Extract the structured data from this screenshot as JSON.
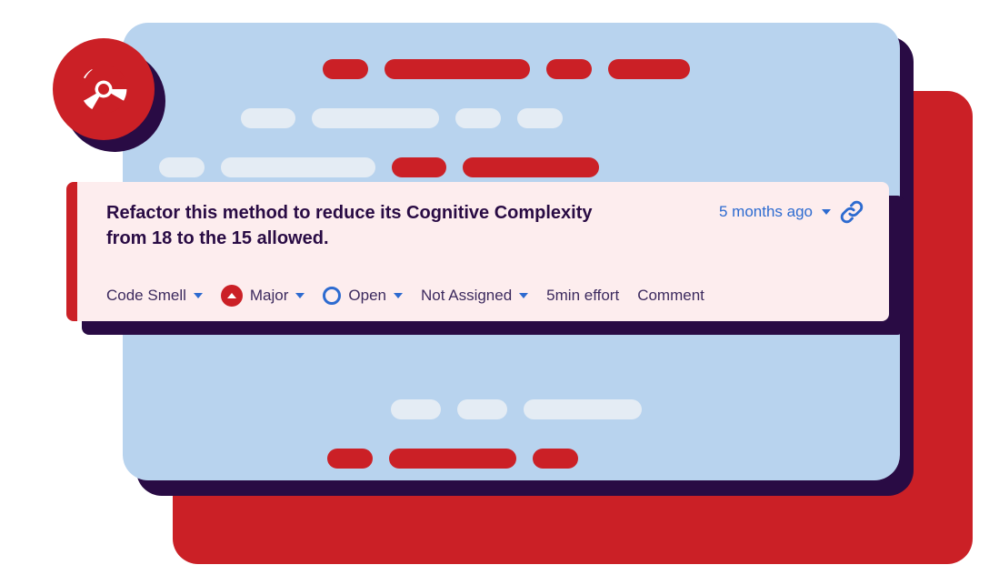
{
  "issue": {
    "message": "Refactor this method to reduce its Cognitive Complexity from 18 to the 15 allowed.",
    "age": "5 months ago",
    "type": "Code Smell",
    "severity": "Major",
    "status": "Open",
    "assignee": "Not Assigned",
    "effort": "5min effort",
    "comment_label": "Comment"
  },
  "colors": {
    "accent_red": "#CB2026",
    "dark_purple": "#290B44",
    "panel_blue": "#B8D3EE",
    "pale": "#E4ECF4",
    "link_blue": "#2D6BD0",
    "card_pink": "#FDEDEE"
  }
}
